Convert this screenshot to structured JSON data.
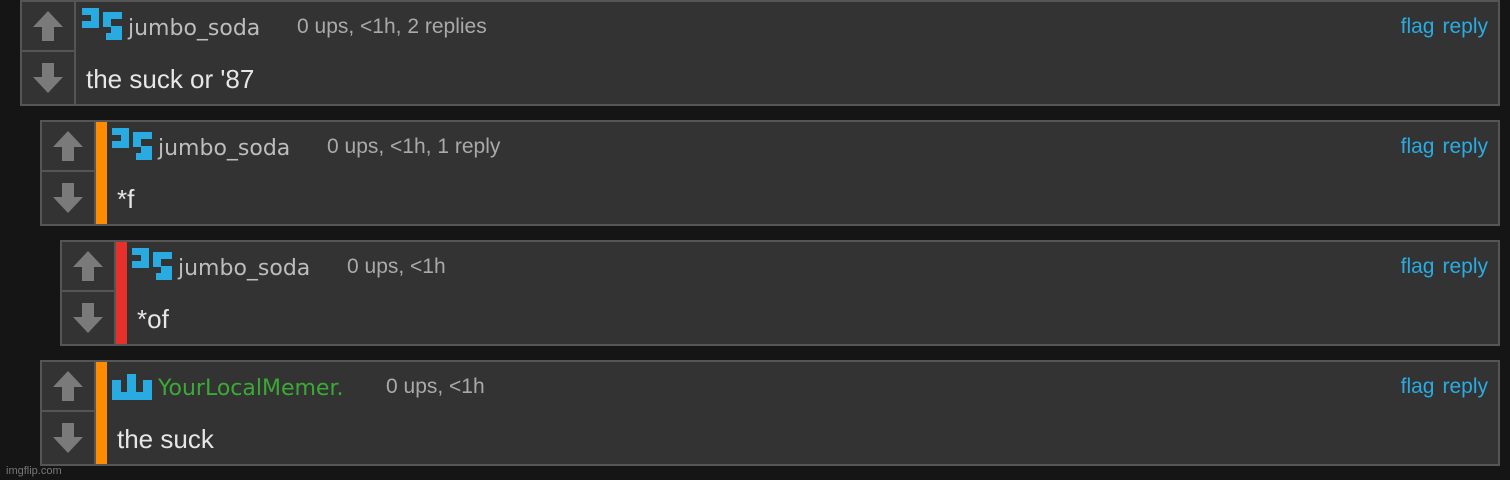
{
  "colors": {
    "accent": "#29abe2",
    "depth_orange": "#ff8c00",
    "depth_red": "#e8302b",
    "username_green": "#3aaa35",
    "username_gray": "#bdbdbd"
  },
  "actions": {
    "flag": "flag",
    "reply": "reply"
  },
  "comments": [
    {
      "username": "jumbo_soda",
      "meta": "0 ups, <1h, 2 replies",
      "text": "the suck or '87"
    },
    {
      "username": "jumbo_soda",
      "meta": "0 ups, <1h, 1 reply",
      "text": "*f"
    },
    {
      "username": "jumbo_soda",
      "meta": "0 ups, <1h",
      "text": "*of"
    },
    {
      "username": "YourLocalMemer.",
      "meta": "0 ups, <1h",
      "text": "the suck"
    }
  ],
  "watermark": "imgflip.com"
}
